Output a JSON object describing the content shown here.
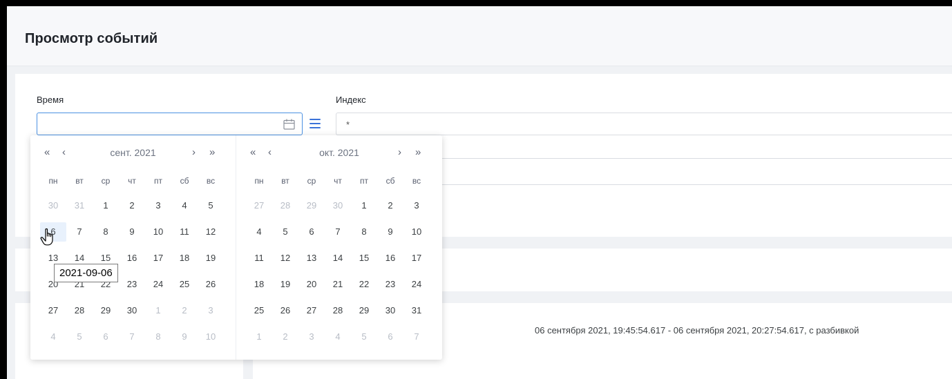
{
  "page": {
    "title": "Просмотр событий"
  },
  "filters": {
    "time_label": "Время",
    "time_value": "",
    "index_label": "Индекс",
    "index_value": "*"
  },
  "icons": {
    "calendar": "calendar-icon",
    "menu": "menu-icon",
    "pointer": "hand-pointer-icon"
  },
  "datepicker": {
    "nav": {
      "prev_year": "«",
      "prev_month": "‹",
      "next_month": "›",
      "next_year": "»"
    },
    "weekdays": [
      "пн",
      "вт",
      "ср",
      "чт",
      "пт",
      "сб",
      "вс"
    ],
    "months": [
      {
        "label": "сент. 2021",
        "weeks": [
          [
            "30",
            "31",
            "1",
            "2",
            "3",
            "4",
            "5"
          ],
          [
            "6",
            "7",
            "8",
            "9",
            "10",
            "11",
            "12"
          ],
          [
            "13",
            "14",
            "15",
            "16",
            "17",
            "18",
            "19"
          ],
          [
            "20",
            "21",
            "22",
            "23",
            "24",
            "25",
            "26"
          ],
          [
            "27",
            "28",
            "29",
            "30",
            "1",
            "2",
            "3"
          ],
          [
            "4",
            "5",
            "6",
            "7",
            "8",
            "9",
            "10"
          ]
        ],
        "muted": [
          [
            1,
            1,
            0,
            0,
            0,
            0,
            0
          ],
          [
            0,
            0,
            0,
            0,
            0,
            0,
            0
          ],
          [
            0,
            0,
            0,
            0,
            0,
            0,
            0
          ],
          [
            0,
            0,
            0,
            0,
            0,
            0,
            0
          ],
          [
            0,
            0,
            0,
            0,
            1,
            1,
            1
          ],
          [
            1,
            1,
            1,
            1,
            1,
            1,
            1
          ]
        ]
      },
      {
        "label": "окт. 2021",
        "weeks": [
          [
            "27",
            "28",
            "29",
            "30",
            "1",
            "2",
            "3"
          ],
          [
            "4",
            "5",
            "6",
            "7",
            "8",
            "9",
            "10"
          ],
          [
            "11",
            "12",
            "13",
            "14",
            "15",
            "16",
            "17"
          ],
          [
            "18",
            "19",
            "20",
            "21",
            "22",
            "23",
            "24"
          ],
          [
            "25",
            "26",
            "27",
            "28",
            "29",
            "30",
            "31"
          ],
          [
            "1",
            "2",
            "3",
            "4",
            "5",
            "6",
            "7"
          ]
        ],
        "muted": [
          [
            1,
            1,
            1,
            1,
            0,
            0,
            0
          ],
          [
            0,
            0,
            0,
            0,
            0,
            0,
            0
          ],
          [
            0,
            0,
            0,
            0,
            0,
            0,
            0
          ],
          [
            0,
            0,
            0,
            0,
            0,
            0,
            0
          ],
          [
            0,
            0,
            0,
            0,
            0,
            0,
            0
          ],
          [
            1,
            1,
            1,
            1,
            1,
            1,
            1
          ]
        ]
      }
    ],
    "hovered_day": "6",
    "tooltip": "2021-09-06"
  },
  "results": {
    "range_text": "06 сентября 2021, 19:45:54.617 - 06 сентября 2021, 20:27:54.617, с разбивкой"
  }
}
